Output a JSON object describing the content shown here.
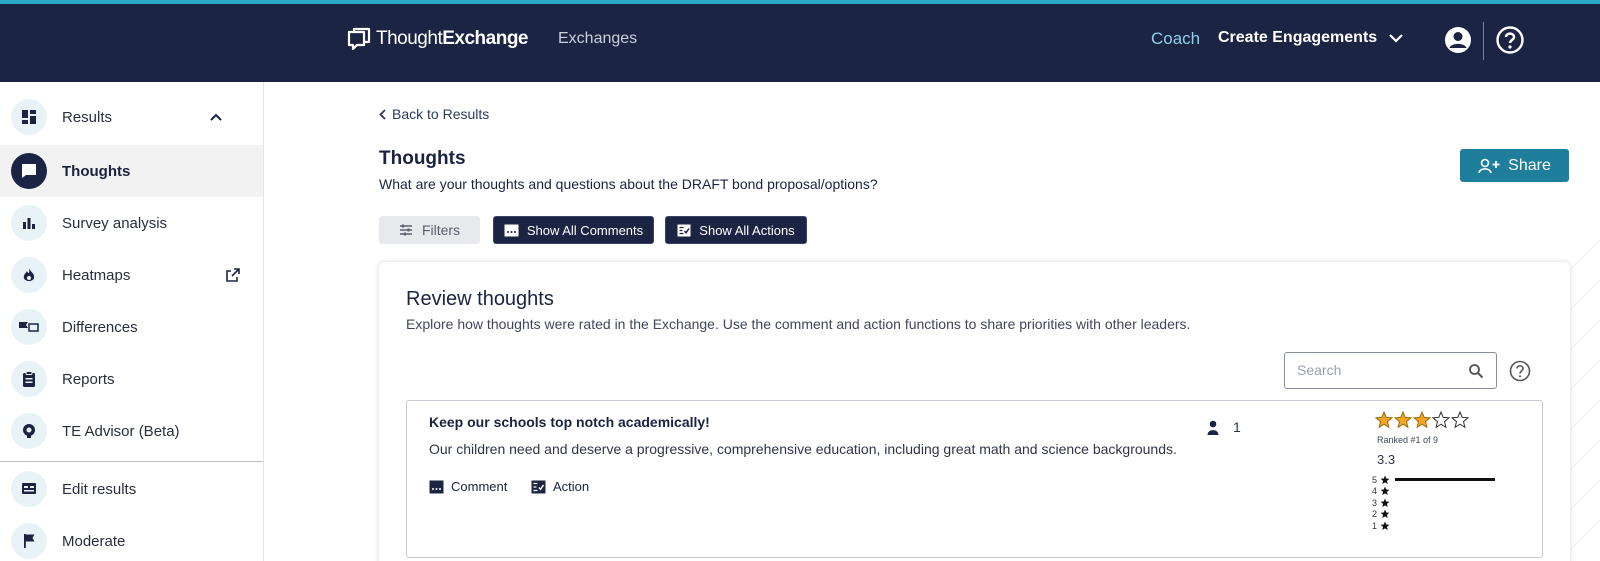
{
  "brand": {
    "logo_regular": "Thought",
    "logo_bold": "Exchange",
    "accent": "#2aa9c7",
    "header_bg": "#1b2442",
    "share_color": "#1f7e9c"
  },
  "header": {
    "nav_exchanges": "Exchanges",
    "nav_coach": "Coach",
    "nav_create": "Create Engagements"
  },
  "sidebar": {
    "items": [
      {
        "label": "Results",
        "icon": "dashboard-icon"
      },
      {
        "label": "Thoughts",
        "icon": "chat-bubble-icon"
      },
      {
        "label": "Survey analysis",
        "icon": "bar-chart-icon"
      },
      {
        "label": "Heatmaps",
        "icon": "flame-icon"
      },
      {
        "label": "Differences",
        "icon": "compare-flags-icon"
      },
      {
        "label": "Reports",
        "icon": "clipboard-icon"
      },
      {
        "label": "TE Advisor (Beta)",
        "icon": "advisor-badge-icon"
      },
      {
        "label": "Edit results",
        "icon": "edit-results-icon"
      },
      {
        "label": "Moderate",
        "icon": "flag-icon"
      }
    ]
  },
  "main": {
    "back_label": "Back to Results",
    "title": "Thoughts",
    "question": "What are your thoughts and questions about the DRAFT bond proposal/options?",
    "share_label": "Share",
    "filters_label": "Filters",
    "show_comments_label": "Show All Comments",
    "show_actions_label": "Show All Actions"
  },
  "review": {
    "title": "Review thoughts",
    "description": "Explore how thoughts were rated in the Exchange. Use the comment and action functions to share priorities with other leaders.",
    "search_placeholder": "Search"
  },
  "thoughts": [
    {
      "title": "Keep our schools top notch academically!",
      "body": "Our children need and deserve a progressive, comprehensive education, including great math and science backgrounds.",
      "comment_label": "Comment",
      "action_label": "Action",
      "participants": "1",
      "stars_filled": 3,
      "stars_total": 5,
      "rank": "Ranked #1 of 9",
      "average": "3.3",
      "distribution": [
        {
          "star": "5",
          "fraction": 1.0
        },
        {
          "star": "4",
          "fraction": 0
        },
        {
          "star": "3",
          "fraction": 0
        },
        {
          "star": "2",
          "fraction": 0
        },
        {
          "star": "1",
          "fraction": 0
        }
      ]
    }
  ]
}
